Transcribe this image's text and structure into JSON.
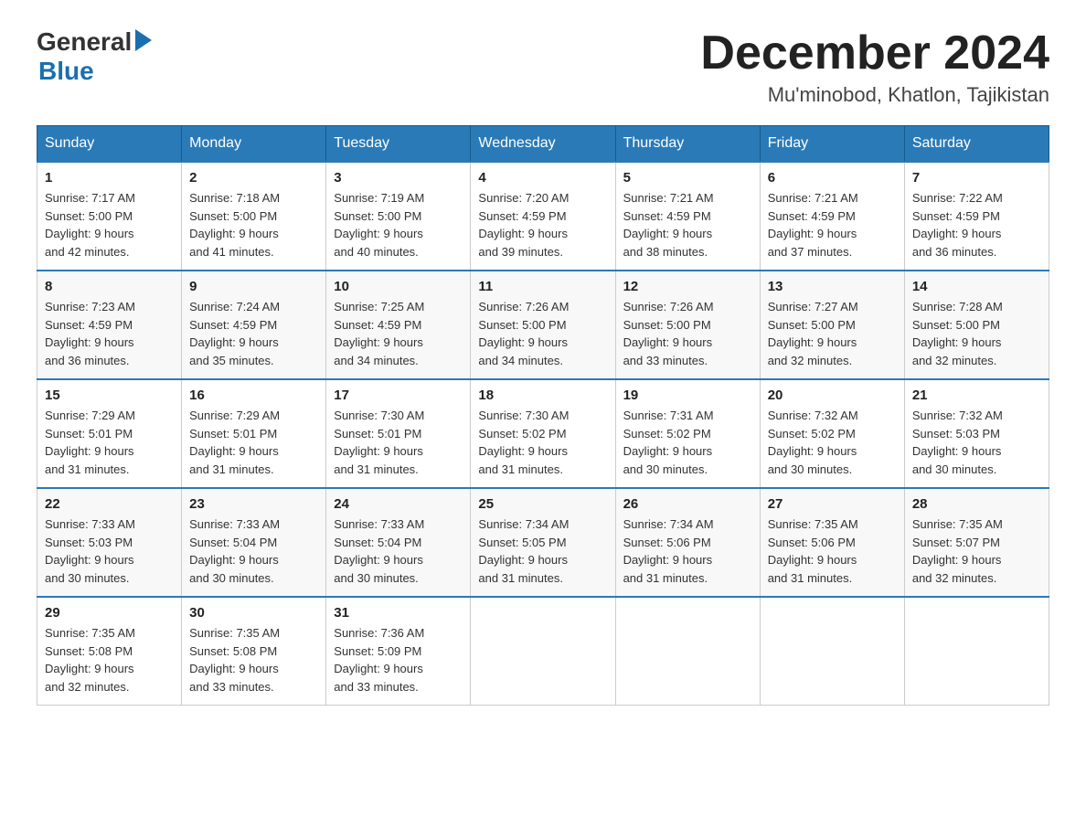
{
  "header": {
    "logo_general": "General",
    "logo_blue": "Blue",
    "month_title": "December 2024",
    "location": "Mu'minobod, Khatlon, Tajikistan"
  },
  "days_of_week": [
    "Sunday",
    "Monday",
    "Tuesday",
    "Wednesday",
    "Thursday",
    "Friday",
    "Saturday"
  ],
  "weeks": [
    [
      {
        "day": "1",
        "sunrise": "7:17 AM",
        "sunset": "5:00 PM",
        "daylight": "9 hours and 42 minutes."
      },
      {
        "day": "2",
        "sunrise": "7:18 AM",
        "sunset": "5:00 PM",
        "daylight": "9 hours and 41 minutes."
      },
      {
        "day": "3",
        "sunrise": "7:19 AM",
        "sunset": "5:00 PM",
        "daylight": "9 hours and 40 minutes."
      },
      {
        "day": "4",
        "sunrise": "7:20 AM",
        "sunset": "4:59 PM",
        "daylight": "9 hours and 39 minutes."
      },
      {
        "day": "5",
        "sunrise": "7:21 AM",
        "sunset": "4:59 PM",
        "daylight": "9 hours and 38 minutes."
      },
      {
        "day": "6",
        "sunrise": "7:21 AM",
        "sunset": "4:59 PM",
        "daylight": "9 hours and 37 minutes."
      },
      {
        "day": "7",
        "sunrise": "7:22 AM",
        "sunset": "4:59 PM",
        "daylight": "9 hours and 36 minutes."
      }
    ],
    [
      {
        "day": "8",
        "sunrise": "7:23 AM",
        "sunset": "4:59 PM",
        "daylight": "9 hours and 36 minutes."
      },
      {
        "day": "9",
        "sunrise": "7:24 AM",
        "sunset": "4:59 PM",
        "daylight": "9 hours and 35 minutes."
      },
      {
        "day": "10",
        "sunrise": "7:25 AM",
        "sunset": "4:59 PM",
        "daylight": "9 hours and 34 minutes."
      },
      {
        "day": "11",
        "sunrise": "7:26 AM",
        "sunset": "5:00 PM",
        "daylight": "9 hours and 34 minutes."
      },
      {
        "day": "12",
        "sunrise": "7:26 AM",
        "sunset": "5:00 PM",
        "daylight": "9 hours and 33 minutes."
      },
      {
        "day": "13",
        "sunrise": "7:27 AM",
        "sunset": "5:00 PM",
        "daylight": "9 hours and 32 minutes."
      },
      {
        "day": "14",
        "sunrise": "7:28 AM",
        "sunset": "5:00 PM",
        "daylight": "9 hours and 32 minutes."
      }
    ],
    [
      {
        "day": "15",
        "sunrise": "7:29 AM",
        "sunset": "5:01 PM",
        "daylight": "9 hours and 31 minutes."
      },
      {
        "day": "16",
        "sunrise": "7:29 AM",
        "sunset": "5:01 PM",
        "daylight": "9 hours and 31 minutes."
      },
      {
        "day": "17",
        "sunrise": "7:30 AM",
        "sunset": "5:01 PM",
        "daylight": "9 hours and 31 minutes."
      },
      {
        "day": "18",
        "sunrise": "7:30 AM",
        "sunset": "5:02 PM",
        "daylight": "9 hours and 31 minutes."
      },
      {
        "day": "19",
        "sunrise": "7:31 AM",
        "sunset": "5:02 PM",
        "daylight": "9 hours and 30 minutes."
      },
      {
        "day": "20",
        "sunrise": "7:32 AM",
        "sunset": "5:02 PM",
        "daylight": "9 hours and 30 minutes."
      },
      {
        "day": "21",
        "sunrise": "7:32 AM",
        "sunset": "5:03 PM",
        "daylight": "9 hours and 30 minutes."
      }
    ],
    [
      {
        "day": "22",
        "sunrise": "7:33 AM",
        "sunset": "5:03 PM",
        "daylight": "9 hours and 30 minutes."
      },
      {
        "day": "23",
        "sunrise": "7:33 AM",
        "sunset": "5:04 PM",
        "daylight": "9 hours and 30 minutes."
      },
      {
        "day": "24",
        "sunrise": "7:33 AM",
        "sunset": "5:04 PM",
        "daylight": "9 hours and 30 minutes."
      },
      {
        "day": "25",
        "sunrise": "7:34 AM",
        "sunset": "5:05 PM",
        "daylight": "9 hours and 31 minutes."
      },
      {
        "day": "26",
        "sunrise": "7:34 AM",
        "sunset": "5:06 PM",
        "daylight": "9 hours and 31 minutes."
      },
      {
        "day": "27",
        "sunrise": "7:35 AM",
        "sunset": "5:06 PM",
        "daylight": "9 hours and 31 minutes."
      },
      {
        "day": "28",
        "sunrise": "7:35 AM",
        "sunset": "5:07 PM",
        "daylight": "9 hours and 32 minutes."
      }
    ],
    [
      {
        "day": "29",
        "sunrise": "7:35 AM",
        "sunset": "5:08 PM",
        "daylight": "9 hours and 32 minutes."
      },
      {
        "day": "30",
        "sunrise": "7:35 AM",
        "sunset": "5:08 PM",
        "daylight": "9 hours and 33 minutes."
      },
      {
        "day": "31",
        "sunrise": "7:36 AM",
        "sunset": "5:09 PM",
        "daylight": "9 hours and 33 minutes."
      },
      null,
      null,
      null,
      null
    ]
  ],
  "labels": {
    "sunrise": "Sunrise:",
    "sunset": "Sunset:",
    "daylight": "Daylight:"
  }
}
